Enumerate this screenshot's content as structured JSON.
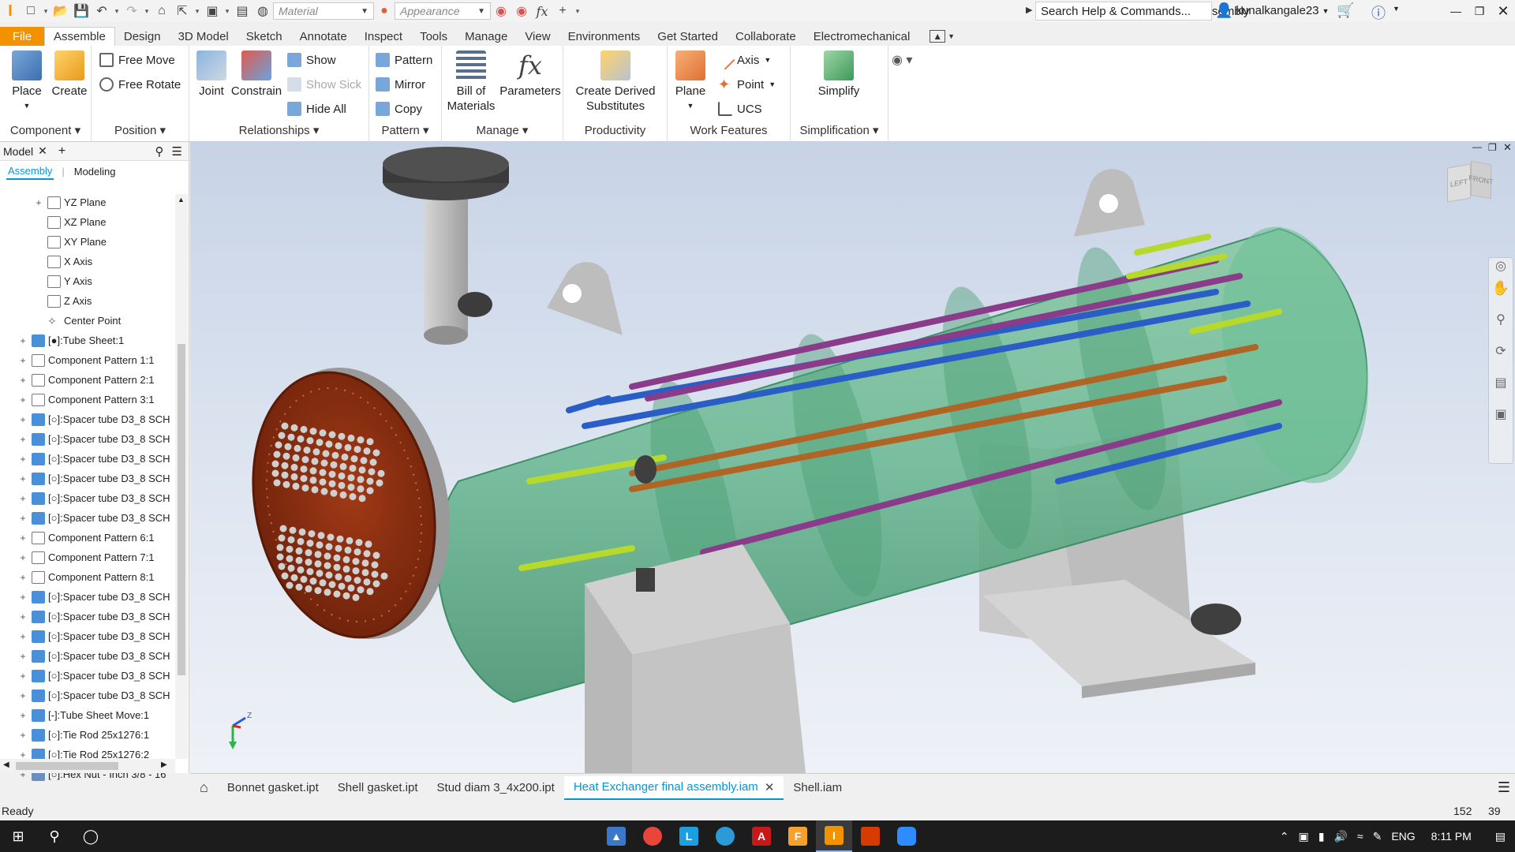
{
  "window": {
    "title": "Heat Exchanger final assembly",
    "search_placeholder": "Search Help & Commands...",
    "user": "kunalkangale23",
    "material_select": "Material",
    "appearance_select": "Appearance"
  },
  "menu_tabs": [
    "File",
    "Assemble",
    "Design",
    "3D Model",
    "Sketch",
    "Annotate",
    "Inspect",
    "Tools",
    "Manage",
    "View",
    "Environments",
    "Get Started",
    "Collaborate",
    "Electromechanical"
  ],
  "ribbon": {
    "component": {
      "label": "Component",
      "place": "Place",
      "create": "Create"
    },
    "position": {
      "label": "Position",
      "free_move": "Free Move",
      "free_rotate": "Free Rotate"
    },
    "relationships": {
      "label": "Relationships",
      "joint": "Joint",
      "constrain": "Constrain",
      "show": "Show",
      "show_sick": "Show Sick",
      "hide_all": "Hide All"
    },
    "pattern": {
      "label": "Pattern",
      "pattern": "Pattern",
      "mirror": "Mirror",
      "copy": "Copy"
    },
    "manage": {
      "label": "Manage",
      "bom_line1": "Bill of",
      "bom_line2": "Materials",
      "parameters": "Parameters"
    },
    "productivity": {
      "label": "Productivity",
      "cds_line1": "Create Derived",
      "cds_line2": "Substitutes"
    },
    "work_features": {
      "label": "Work Features",
      "plane": "Plane",
      "axis": "Axis",
      "point": "Point",
      "ucs": "UCS"
    },
    "simplification": {
      "label": "Simplification",
      "simplify": "Simplify"
    }
  },
  "browser": {
    "title": "Model",
    "tabs": [
      "Assembly",
      "Modeling"
    ],
    "tree": [
      {
        "label": "YZ Plane",
        "indent": 2,
        "icon": "plane",
        "expand": "+"
      },
      {
        "label": "XZ Plane",
        "indent": 2,
        "icon": "plane",
        "expand": ""
      },
      {
        "label": "XY Plane",
        "indent": 2,
        "icon": "plane",
        "expand": ""
      },
      {
        "label": "X Axis",
        "indent": 2,
        "icon": "axis",
        "expand": ""
      },
      {
        "label": "Y Axis",
        "indent": 2,
        "icon": "axis",
        "expand": ""
      },
      {
        "label": "Z Axis",
        "indent": 2,
        "icon": "axis",
        "expand": ""
      },
      {
        "label": "Center Point",
        "indent": 2,
        "icon": "point",
        "expand": ""
      },
      {
        "label": "[●]:Tube Sheet:1",
        "indent": 1,
        "icon": "part",
        "expand": "+"
      },
      {
        "label": "Component Pattern 1:1",
        "indent": 1,
        "icon": "pattern",
        "expand": "+"
      },
      {
        "label": "Component Pattern 2:1",
        "indent": 1,
        "icon": "pattern",
        "expand": "+"
      },
      {
        "label": "Component Pattern 3:1",
        "indent": 1,
        "icon": "pattern",
        "expand": "+"
      },
      {
        "label": "[○]:Spacer tube D3_8 SCH",
        "indent": 1,
        "icon": "part",
        "expand": "+"
      },
      {
        "label": "[○]:Spacer tube D3_8 SCH",
        "indent": 1,
        "icon": "part",
        "expand": "+"
      },
      {
        "label": "[○]:Spacer tube D3_8 SCH",
        "indent": 1,
        "icon": "part",
        "expand": "+"
      },
      {
        "label": "[○]:Spacer tube D3_8 SCH",
        "indent": 1,
        "icon": "part",
        "expand": "+"
      },
      {
        "label": "[○]:Spacer tube D3_8 SCH",
        "indent": 1,
        "icon": "part",
        "expand": "+"
      },
      {
        "label": "[○]:Spacer tube D3_8 SCH",
        "indent": 1,
        "icon": "part",
        "expand": "+"
      },
      {
        "label": "Component Pattern 6:1",
        "indent": 1,
        "icon": "pattern",
        "expand": "+"
      },
      {
        "label": "Component Pattern 7:1",
        "indent": 1,
        "icon": "pattern",
        "expand": "+"
      },
      {
        "label": "Component Pattern 8:1",
        "indent": 1,
        "icon": "pattern",
        "expand": "+"
      },
      {
        "label": "[○]:Spacer tube D3_8 SCH",
        "indent": 1,
        "icon": "part",
        "expand": "+"
      },
      {
        "label": "[○]:Spacer tube D3_8 SCH",
        "indent": 1,
        "icon": "part",
        "expand": "+"
      },
      {
        "label": "[○]:Spacer tube D3_8 SCH",
        "indent": 1,
        "icon": "part",
        "expand": "+"
      },
      {
        "label": "[○]:Spacer tube D3_8 SCH",
        "indent": 1,
        "icon": "part",
        "expand": "+"
      },
      {
        "label": "[○]:Spacer tube D3_8 SCH",
        "indent": 1,
        "icon": "part",
        "expand": "+"
      },
      {
        "label": "[○]:Spacer tube D3_8 SCH",
        "indent": 1,
        "icon": "part",
        "expand": "+"
      },
      {
        "label": "[-]:Tube Sheet Move:1",
        "indent": 1,
        "icon": "part",
        "expand": "+"
      },
      {
        "label": "[○]:Tie Rod 25x1276:1",
        "indent": 1,
        "icon": "part",
        "expand": "+"
      },
      {
        "label": "[○]:Tie Rod 25x1276:2",
        "indent": 1,
        "icon": "part",
        "expand": "+"
      },
      {
        "label": "[○]:Hex Nut - Inch 3/8 - 16",
        "indent": 1,
        "icon": "nut",
        "expand": "+"
      }
    ]
  },
  "viewcube": {
    "front": "LEFT",
    "right": "FRONT"
  },
  "doc_tabs": [
    "Bonnet gasket.ipt",
    "Shell gasket.ipt",
    "Stud diam 3_4x200.ipt",
    "Heat Exchanger final assembly.iam",
    "Shell.iam"
  ],
  "active_doc_tab": 3,
  "status": {
    "text": "Ready",
    "count1": "152",
    "count2": "39"
  },
  "taskbar": {
    "language": "ENG",
    "time": "8:11 PM"
  },
  "colors": {
    "file_tab": "#f39200",
    "accent": "#0696d7",
    "shell": "#5fb48a",
    "tube_sheet": "#8a2d10",
    "support": "#c8c8c8"
  }
}
